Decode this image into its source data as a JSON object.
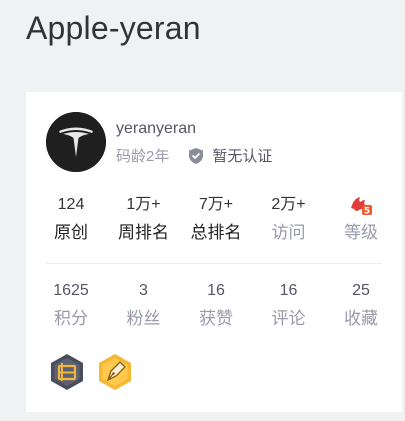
{
  "blog": {
    "title": "Apple-yeran"
  },
  "profile": {
    "username": "yeranyeran",
    "code_age": "码龄2年",
    "verify_text": "暂无认证"
  },
  "stats_row1": [
    {
      "value": "124",
      "label": "原创"
    },
    {
      "value": "1万+",
      "label": "周排名"
    },
    {
      "value": "7万+",
      "label": "总排名"
    },
    {
      "value": "2万+",
      "label": "访问"
    },
    {
      "value": "",
      "label": "等级"
    }
  ],
  "stats_row2": [
    {
      "value": "1625",
      "label": "积分"
    },
    {
      "value": "3",
      "label": "粉丝"
    },
    {
      "value": "16",
      "label": "获赞"
    },
    {
      "value": "16",
      "label": "评论"
    },
    {
      "value": "25",
      "label": "收藏"
    }
  ],
  "badges": [
    {
      "icon": "persistence-badge-icon"
    },
    {
      "icon": "pen-badge-icon"
    }
  ],
  "level_icon": "level-5-icon"
}
